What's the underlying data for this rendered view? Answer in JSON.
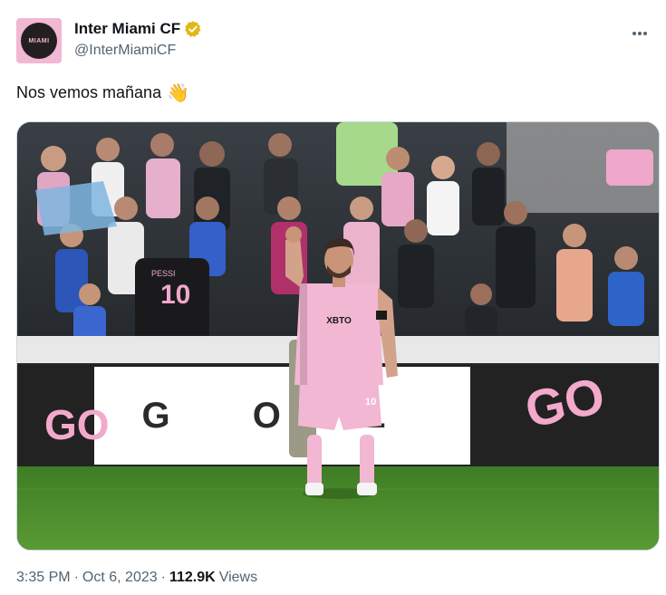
{
  "account": {
    "display_name": "Inter Miami CF",
    "handle": "@InterMiamiCF",
    "avatar_icon": "inter-miami-crest-icon",
    "avatar_text": "MIAMI",
    "verified_color": "#e2b719"
  },
  "tweet": {
    "text": "Nos vemos mañana",
    "emoji": "👋"
  },
  "media": {
    "banner_text": "G O L",
    "jersey_player_name": "PESSI",
    "jersey_player_number": "10",
    "shirt_sponsor": "XBTO",
    "shorts_number": "10",
    "board_text_left": "GO",
    "board_text_right": "GO"
  },
  "footer": {
    "time": "3:35 PM",
    "separator": "·",
    "date": "Oct 6, 2023",
    "views_count": "112.9K",
    "views_label": "Views"
  },
  "colors": {
    "brand_pink": "#f2b7d2",
    "grass": "#4a8a2c",
    "text_secondary": "#536471"
  }
}
